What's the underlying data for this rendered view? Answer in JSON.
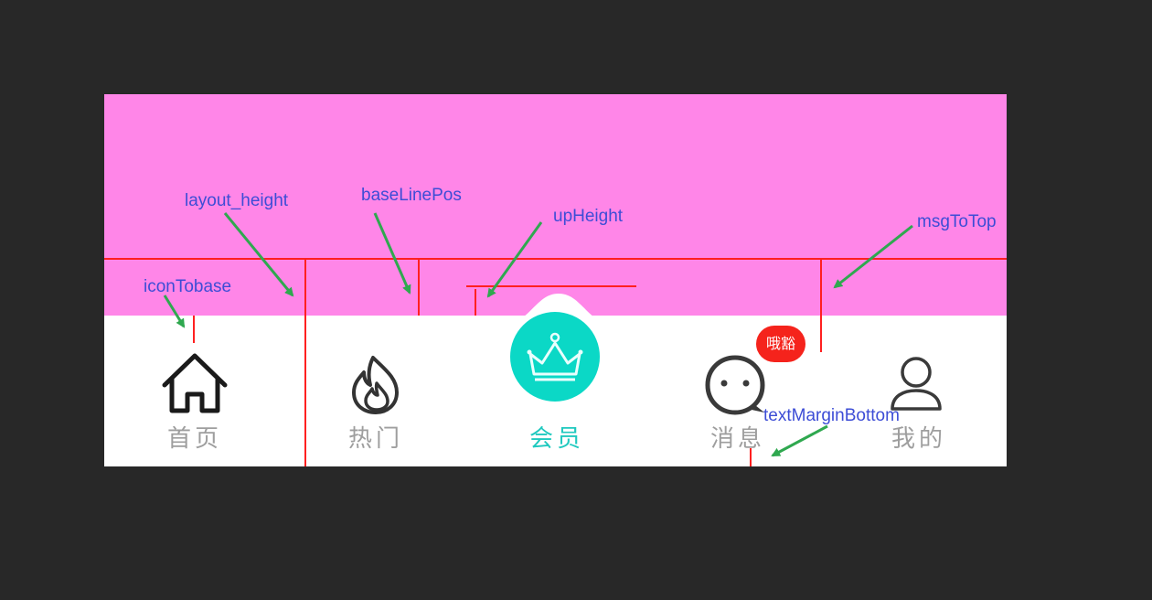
{
  "tabs": [
    {
      "label": "首页",
      "icon": "home-icon"
    },
    {
      "label": "热门",
      "icon": "flame-icon"
    },
    {
      "label": "会员",
      "icon": "crown-icon",
      "active": true
    },
    {
      "label": "消息",
      "icon": "chat-bubble-icon"
    },
    {
      "label": "我的",
      "icon": "user-icon"
    }
  ],
  "badge_text": "哦豁",
  "annotations": {
    "layout_height": "layout_height",
    "baseLinePos": "baseLinePos",
    "upHeight": "upHeight",
    "msgToTop": "msgToTop",
    "iconTobase": "iconTobase",
    "textMarginBottom": "textMarginBottom"
  },
  "colors": {
    "background": "#282828",
    "top_area": "#ff86e8",
    "tab_bar": "#ffffff",
    "accent": "#0bd8c6",
    "badge": "#f5231c",
    "guide_line": "#ff0000",
    "arrow": "#2fa84f",
    "annotation_text": "#3d4dd6"
  }
}
